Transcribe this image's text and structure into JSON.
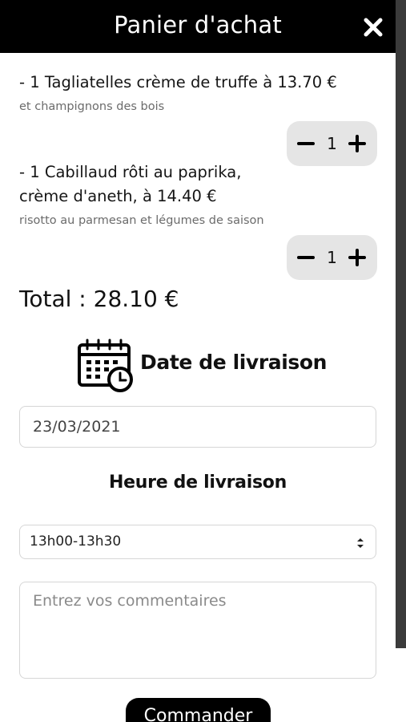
{
  "header": {
    "title": "Panier d'achat"
  },
  "cart": {
    "items": [
      {
        "line1": "- 1 Tagliatelles crème de truffe à 13.70 €",
        "line2": "",
        "subtitle": "et champignons des bois",
        "quantity": "1"
      },
      {
        "line1": "- 1 Cabillaud rôti au paprika,",
        "line2": "crème d'aneth, à 14.40 €",
        "subtitle": "risotto au parmesan et légumes de saison",
        "quantity": "1"
      }
    ],
    "total": "Total : 28.10 €"
  },
  "delivery": {
    "date_label": "Date de livraison",
    "date_value": "23/03/2021",
    "time_label": "Heure de livraison",
    "time_value": "13h00-13h30"
  },
  "comments": {
    "placeholder": "Entrez vos commentaires"
  },
  "order_button": {
    "label": "Commander"
  },
  "icons": {
    "close": "close-icon",
    "minus": "minus-icon",
    "plus": "plus-icon",
    "calendar": "calendar-clock-icon",
    "select": "select-arrows-icon"
  }
}
